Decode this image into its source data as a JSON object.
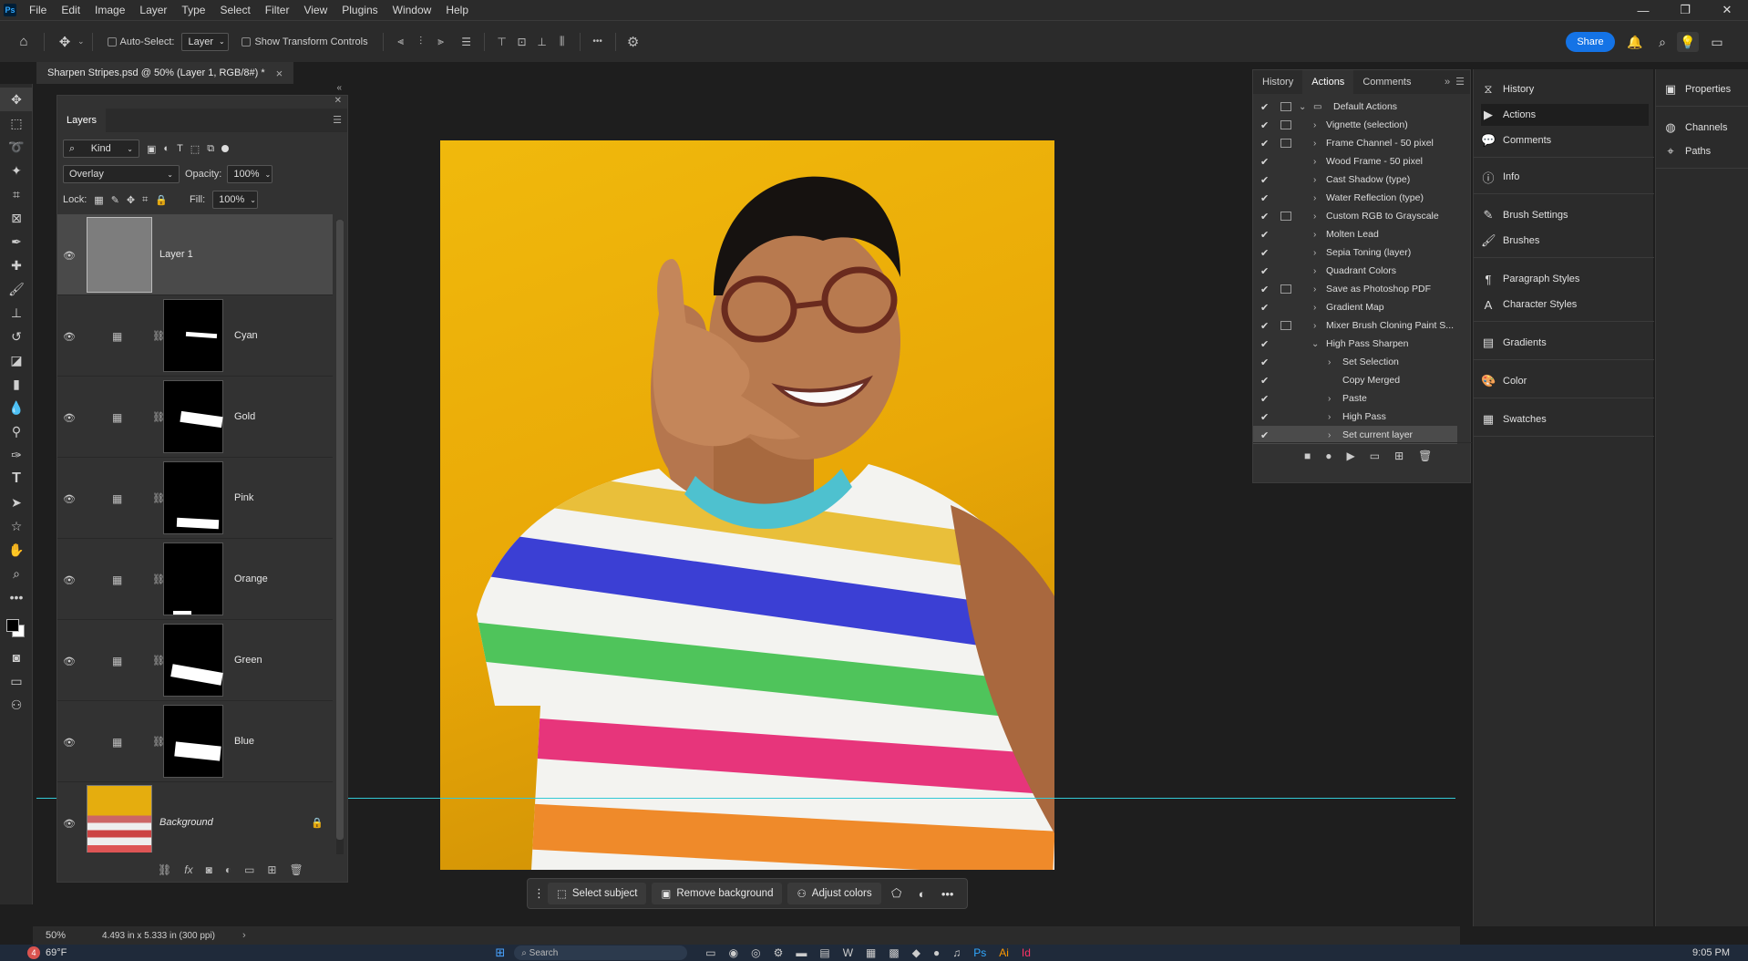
{
  "app": {
    "logo": "Ps"
  },
  "menu": [
    "File",
    "Edit",
    "Image",
    "Layer",
    "Type",
    "Select",
    "Filter",
    "View",
    "Plugins",
    "Window",
    "Help"
  ],
  "window_controls": {
    "minimize": "—",
    "restore": "❐",
    "close": "✕"
  },
  "options": {
    "auto_select_label": "Auto-Select:",
    "auto_select_target": "Layer",
    "show_transform_label": "Show Transform Controls",
    "more": "•••",
    "share_label": "Share"
  },
  "document": {
    "tab_title": "Sharpen Stripes.psd @ 50% (Layer 1, RGB/8#) *",
    "close": "×"
  },
  "layers_panel": {
    "tab": "Layers",
    "filter_kind": "Kind",
    "blend_mode": "Overlay",
    "opacity_label": "Opacity:",
    "opacity_value": "100%",
    "lock_label": "Lock:",
    "fill_label": "Fill:",
    "fill_value": "100%",
    "layers": [
      {
        "name": "Layer 1",
        "selected": true
      },
      {
        "name": "Cyan"
      },
      {
        "name": "Gold"
      },
      {
        "name": "Pink"
      },
      {
        "name": "Orange"
      },
      {
        "name": "Green"
      },
      {
        "name": "Blue"
      },
      {
        "name": "Background",
        "locked": true
      }
    ]
  },
  "actions_panel": {
    "tabs": [
      "History",
      "Actions",
      "Comments"
    ],
    "active_tab": "Actions",
    "set_name": "Default Actions",
    "actions": [
      "Vignette (selection)",
      "Frame Channel - 50 pixel",
      "Wood Frame - 50 pixel",
      "Cast Shadow (type)",
      "Water Reflection (type)",
      "Custom RGB to Grayscale",
      "Molten Lead",
      "Sepia Toning (layer)",
      "Quadrant Colors",
      "Save as Photoshop PDF",
      "Gradient Map",
      "Mixer Brush Cloning Paint S...",
      "High Pass Sharpen"
    ],
    "steps": [
      "Set Selection",
      "Copy Merged",
      "Paste",
      "High Pass",
      "Set current layer"
    ]
  },
  "dock": {
    "group1": [
      {
        "label": "History",
        "icon": "history-icon"
      },
      {
        "label": "Actions",
        "icon": "play-icon",
        "selected": true
      },
      {
        "label": "Comments",
        "icon": "comment-icon"
      },
      {
        "label": "Info",
        "icon": "info-icon"
      },
      {
        "label": "Brush Settings",
        "icon": "brush-settings-icon"
      },
      {
        "label": "Brushes",
        "icon": "brushes-icon"
      },
      {
        "label": "Paragraph Styles",
        "icon": "paragraph-styles-icon"
      },
      {
        "label": "Character Styles",
        "icon": "character-styles-icon"
      },
      {
        "label": "Gradients",
        "icon": "gradients-icon"
      },
      {
        "label": "Color",
        "icon": "color-icon"
      },
      {
        "label": "Swatches",
        "icon": "swatches-icon"
      }
    ],
    "group2": [
      {
        "label": "Properties",
        "icon": "properties-icon"
      },
      {
        "label": "Channels",
        "icon": "channels-icon"
      },
      {
        "label": "Paths",
        "icon": "paths-icon"
      }
    ]
  },
  "context_bar": {
    "select_subject": "Select subject",
    "remove_background": "Remove background",
    "adjust_colors": "Adjust colors"
  },
  "status": {
    "zoom": "50%",
    "doc_size": "4.493 in x 5.333 in (300 ppi)"
  },
  "taskbar": {
    "badge": "4",
    "weather": "69°F",
    "search": "Search",
    "time": "9:05 PM"
  },
  "colors": {
    "accent": "#1473e6",
    "guide": "#33c9d6",
    "background": "#f0b90c"
  }
}
